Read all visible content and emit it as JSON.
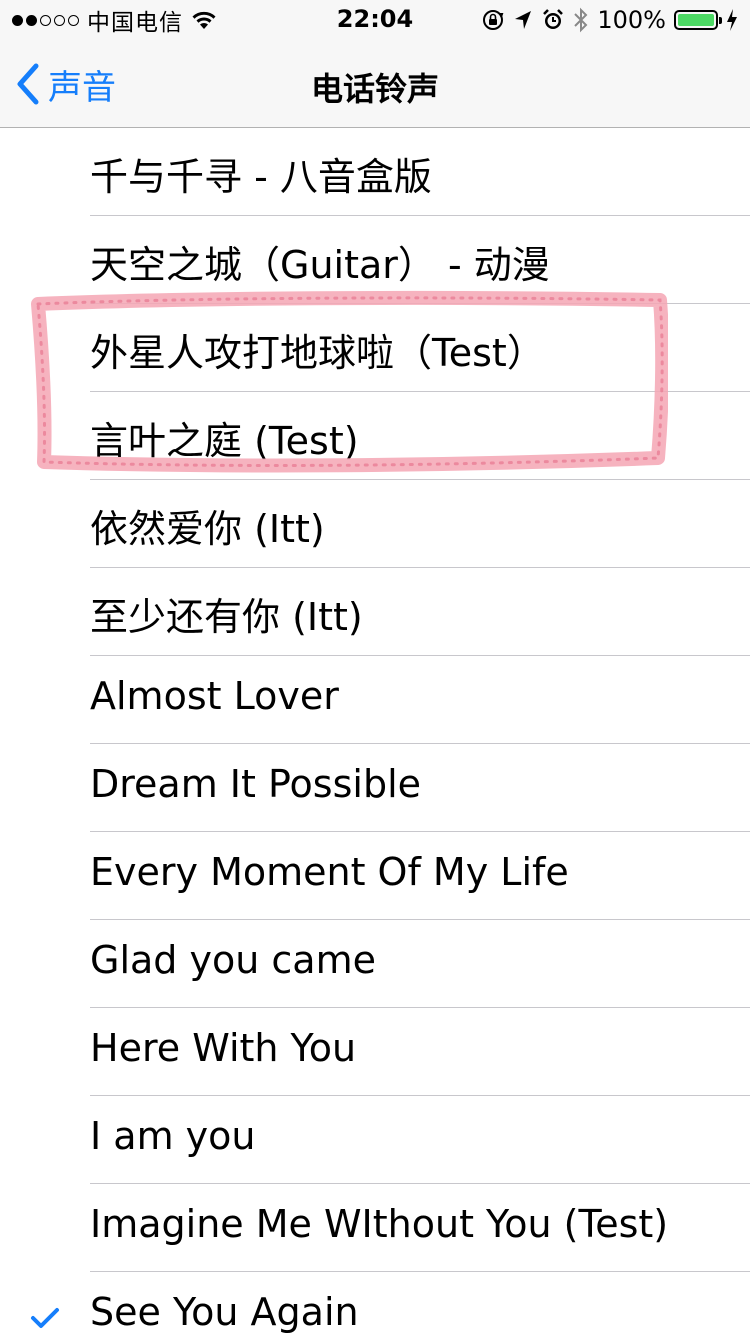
{
  "status_bar": {
    "carrier": "中国电信",
    "signal_bars_filled": 2,
    "signal_bars_total": 5,
    "time": "22:04",
    "battery_percent": "100%",
    "battery_level": 1.0,
    "icons": [
      "wifi-icon",
      "orientation-lock-icon",
      "location-arrow-icon",
      "alarm-icon",
      "bluetooth-icon",
      "battery-icon",
      "charging-icon"
    ]
  },
  "nav": {
    "back_label": "声音",
    "title": "电话铃声"
  },
  "ringtones": [
    {
      "label": "千与千寻 - 八音盒版",
      "selected": false
    },
    {
      "label": "天空之城（Guitar） - 动漫",
      "selected": false
    },
    {
      "label": "外星人攻打地球啦（Test）",
      "selected": false
    },
    {
      "label": "言叶之庭 (Test)",
      "selected": false
    },
    {
      "label": "依然爱你 (Itt)",
      "selected": false
    },
    {
      "label": "至少还有你 (Itt)",
      "selected": false
    },
    {
      "label": "Almost Lover",
      "selected": false
    },
    {
      "label": "Dream It Possible",
      "selected": false
    },
    {
      "label": "Every Moment Of My Life",
      "selected": false
    },
    {
      "label": "Glad you came",
      "selected": false
    },
    {
      "label": "Here With You",
      "selected": false
    },
    {
      "label": "I am you",
      "selected": false
    },
    {
      "label": "Imagine Me WIthout You (Test)",
      "selected": false
    },
    {
      "label": "See You Again",
      "selected": true
    }
  ],
  "colors": {
    "accent": "#157efb",
    "battery": "#4cd964",
    "highlight": "#f4a6b4",
    "separator": "#c8c7cc",
    "bar_background": "#f7f7f7"
  }
}
